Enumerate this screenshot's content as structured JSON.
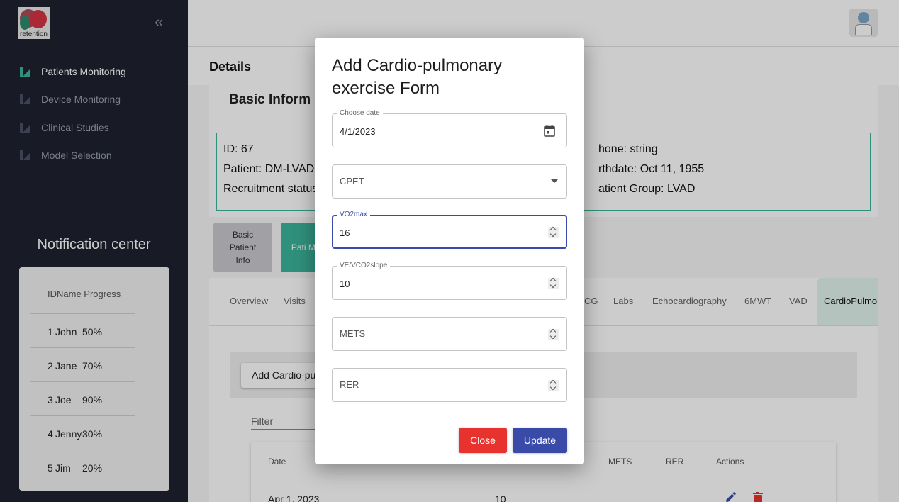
{
  "sidebar": {
    "logo_text": "retention",
    "collapse_icon": "«",
    "items": [
      {
        "label": "Patients Monitoring",
        "active": true
      },
      {
        "label": "Device Monitoring",
        "active": false
      },
      {
        "label": "Clinical Studies",
        "active": false
      },
      {
        "label": "Model Selection",
        "active": false
      }
    ],
    "notification": {
      "title": "Notification center",
      "header": "IDName Progress",
      "rows": [
        {
          "id": "1",
          "name": "John",
          "progress": "50%"
        },
        {
          "id": "2",
          "name": "Jane",
          "progress": "70%"
        },
        {
          "id": "3",
          "name": "Joe",
          "progress": "90%"
        },
        {
          "id": "4",
          "name": "Jenny",
          "progress": "30%"
        },
        {
          "id": "5",
          "name": "Jim",
          "progress": "20%"
        }
      ]
    }
  },
  "main": {
    "details_title": "Details",
    "panel_title": "Basic Inform",
    "info": {
      "id": "ID: 67",
      "patient": "Patient: DM-LVAD-",
      "recruitment": "Recruitment status",
      "phone": "hone: string",
      "birthdate": "rthdate: Oct 11, 1955",
      "group": "atient Group: LVAD"
    },
    "side_buttons": {
      "basic_info": "Basic Patient Info",
      "patient_monitoring": "Pati Monit"
    },
    "tabs": [
      "Overview",
      "Visits",
      "CG",
      "Labs",
      "Echocardiography",
      "6MWT",
      "VAD",
      "CardioPulmon"
    ],
    "add_button": "Add Cardio-pu",
    "filter_label": "Filter",
    "table": {
      "headers": [
        "Date",
        "METS",
        "RER",
        "Actions"
      ],
      "row": {
        "date": "Apr 1, 2023",
        "value": "10"
      }
    }
  },
  "modal": {
    "title": "Add Cardio-pulmonary exercise Form",
    "date_label": "Choose date",
    "date_value": "4/1/2023",
    "type_value": "CPET",
    "vo2max_label": "VO2max",
    "vo2max_value": "16",
    "veco2_label": "VE/VCO2slope",
    "veco2_value": "10",
    "mets_placeholder": "METS",
    "rer_placeholder": "RER",
    "close_label": "Close",
    "update_label": "Update"
  },
  "colors": {
    "sidebar_bg": "#1e2230",
    "accent_green": "#3bb59b",
    "primary_blue": "#3a4aa8",
    "danger_red": "#e8322d"
  }
}
